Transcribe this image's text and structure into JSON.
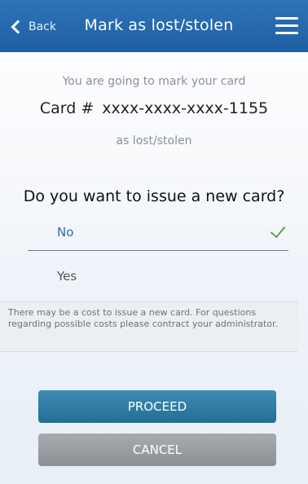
{
  "header": {
    "back_label": "Back",
    "title": "Mark as lost/stolen"
  },
  "content": {
    "intro": "You are going to mark your card",
    "card_label": "Card #",
    "card_number": "xxxx-xxxx-xxxx-1155",
    "lost_text": "as lost/stolen",
    "question": "Do you want to issue a new card?",
    "options": [
      {
        "label": "No",
        "selected": true
      },
      {
        "label": "Yes",
        "selected": false
      }
    ],
    "note": "There may be a cost to issue a new card. For questions regarding possible costs please contract your administrator."
  },
  "buttons": {
    "proceed": "PROCEED",
    "cancel": "CANCEL"
  },
  "colors": {
    "header": "#2a6cb2",
    "proceed": "#2f7aa2",
    "cancel": "#9b9fa3",
    "check": "#5aa64a"
  },
  "icons": {
    "back": "chevron-left-icon",
    "menu": "hamburger-menu-icon",
    "check": "checkmark-icon"
  }
}
